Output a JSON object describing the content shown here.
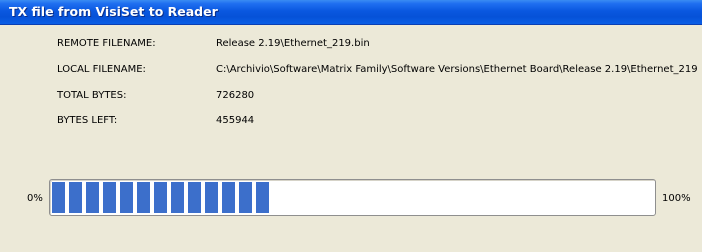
{
  "window": {
    "title": "TX file from VisiSet to Reader"
  },
  "fields": {
    "remote_filename": {
      "label": "REMOTE FILENAME:",
      "value": "Release 2.19\\Ethernet_219.bin"
    },
    "local_filename": {
      "label": "LOCAL FILENAME:",
      "value": "C:\\Archivio\\Software\\Matrix Family\\Software Versions\\Ethernet Board\\Release 2.19\\Ethernet_219"
    },
    "total_bytes": {
      "label": "TOTAL BYTES:",
      "value": "726280"
    },
    "bytes_left": {
      "label": "BYTES LEFT:",
      "value": "455944"
    }
  },
  "progress": {
    "min_label": "0%",
    "max_label": "100%",
    "fraction": 0.38,
    "fill_color": "#3c6fcb"
  }
}
